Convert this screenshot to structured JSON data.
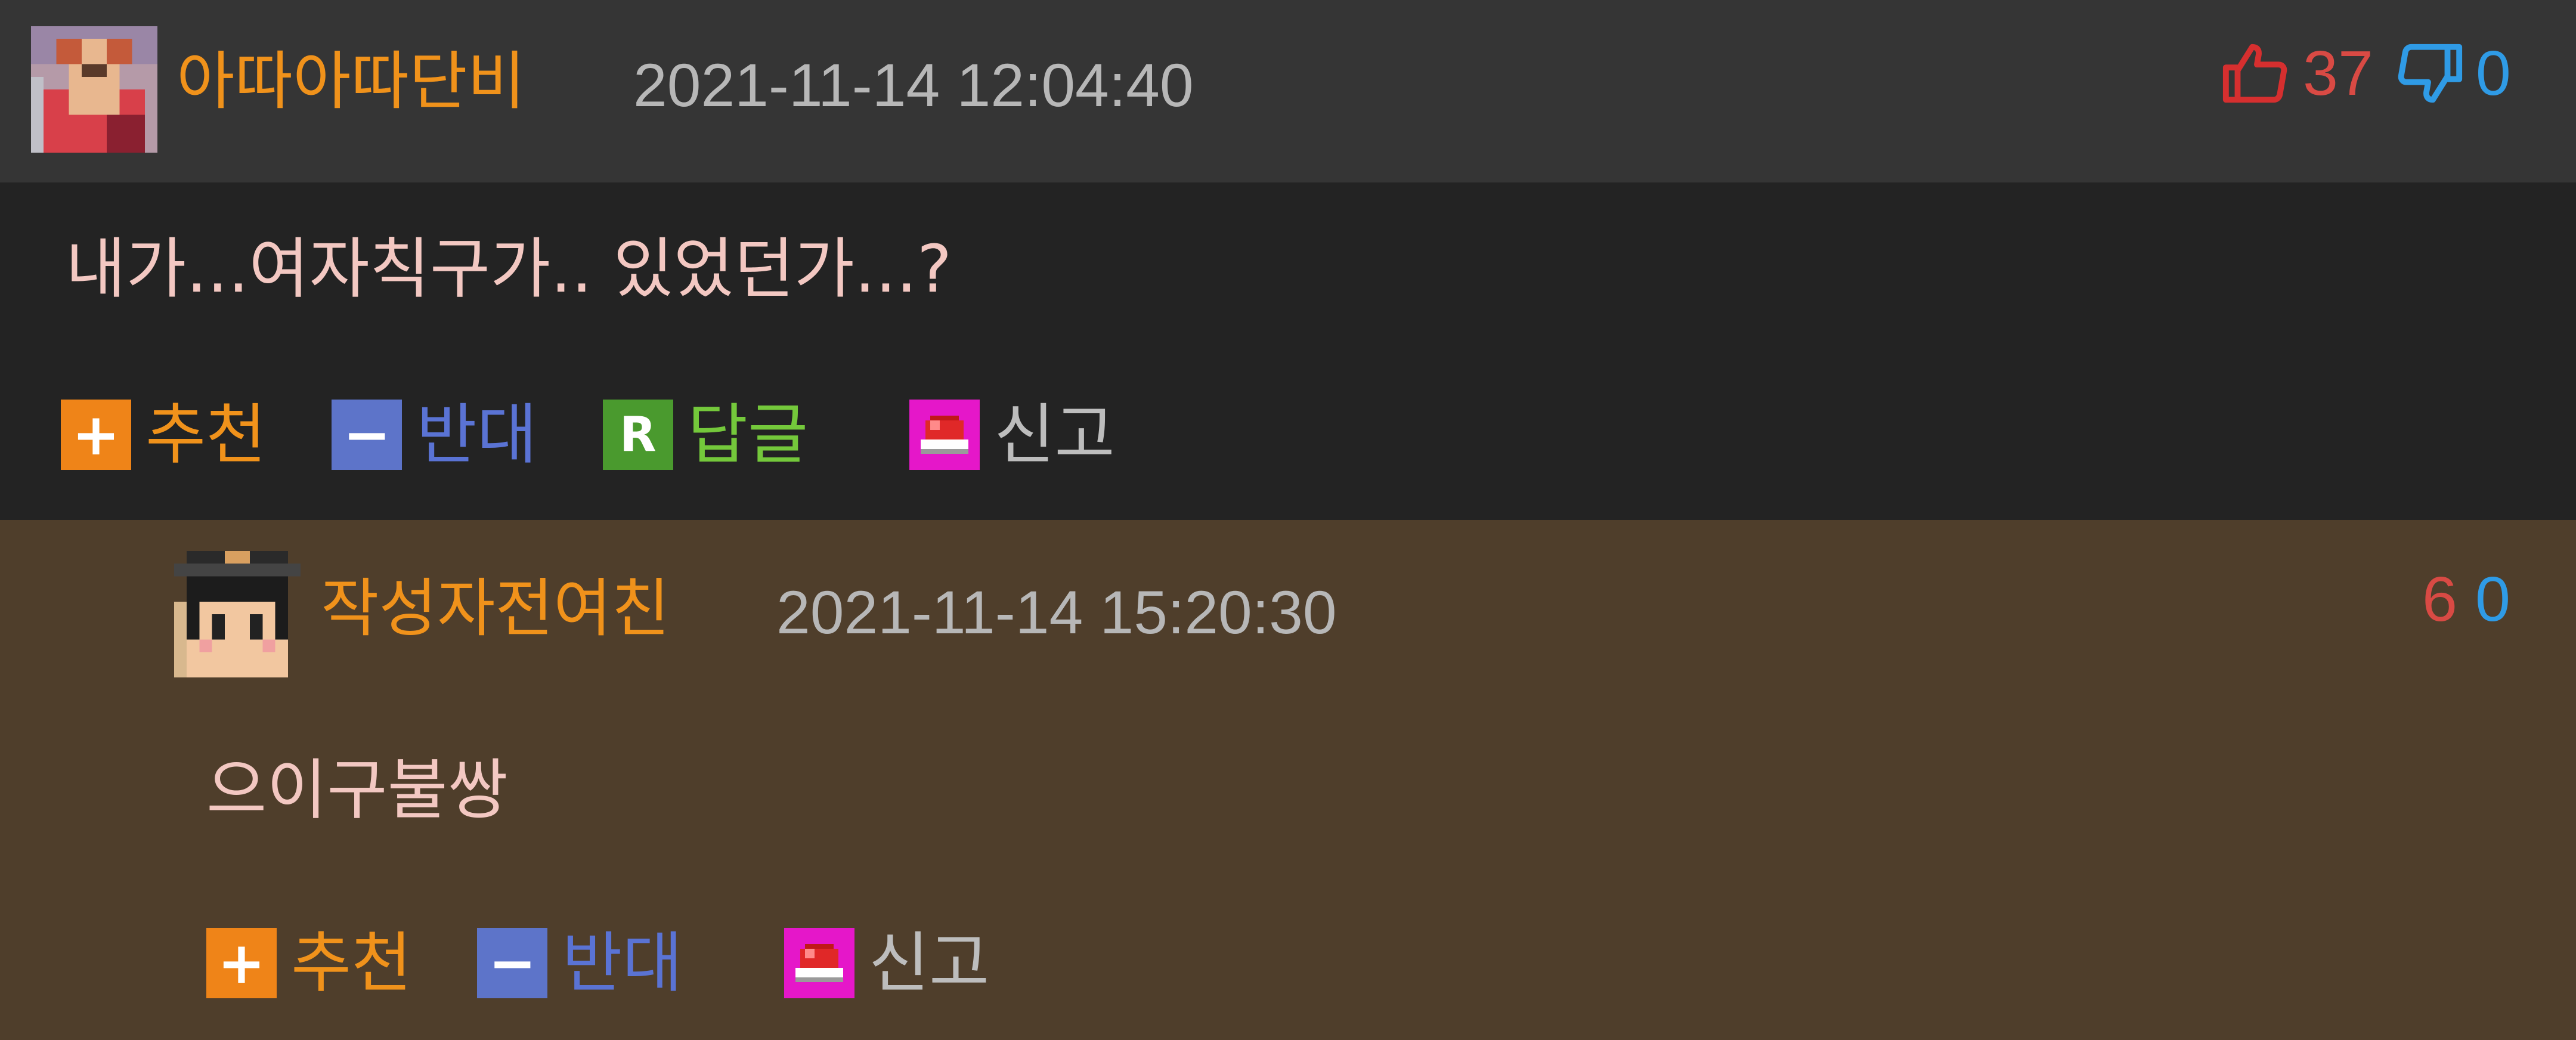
{
  "comment": {
    "nickname": "아따아따단비",
    "datetime": "2021-11-14 12:04:40",
    "upvotes": "37",
    "downvotes": "0",
    "text": "내가...여자칙구가.. 있었던가...?",
    "actions": {
      "recommend": "추천",
      "oppose": "반대",
      "reply": "답글",
      "report": "신고"
    },
    "icons": {
      "up": "thumbs-up-icon",
      "down": "thumbs-down-icon"
    }
  },
  "reply": {
    "nickname": "작성자전여친",
    "datetime": "2021-11-14 15:20:30",
    "upvotes": "6",
    "downvotes": "0",
    "text": "으이구불쌍",
    "actions": {
      "recommend": "추천",
      "oppose": "반대",
      "report": "신고"
    }
  },
  "icon_glyphs": {
    "plus": "+",
    "minus": "−",
    "reply": "R"
  },
  "colors": {
    "header_bg": "#353535",
    "body_bg": "#232323",
    "reply_bg": "#4f3e2b",
    "nickname": "#f0921b",
    "upvote": "#d94a44",
    "downvote": "#2f9be6",
    "comment_text": "#f3c8c2"
  }
}
